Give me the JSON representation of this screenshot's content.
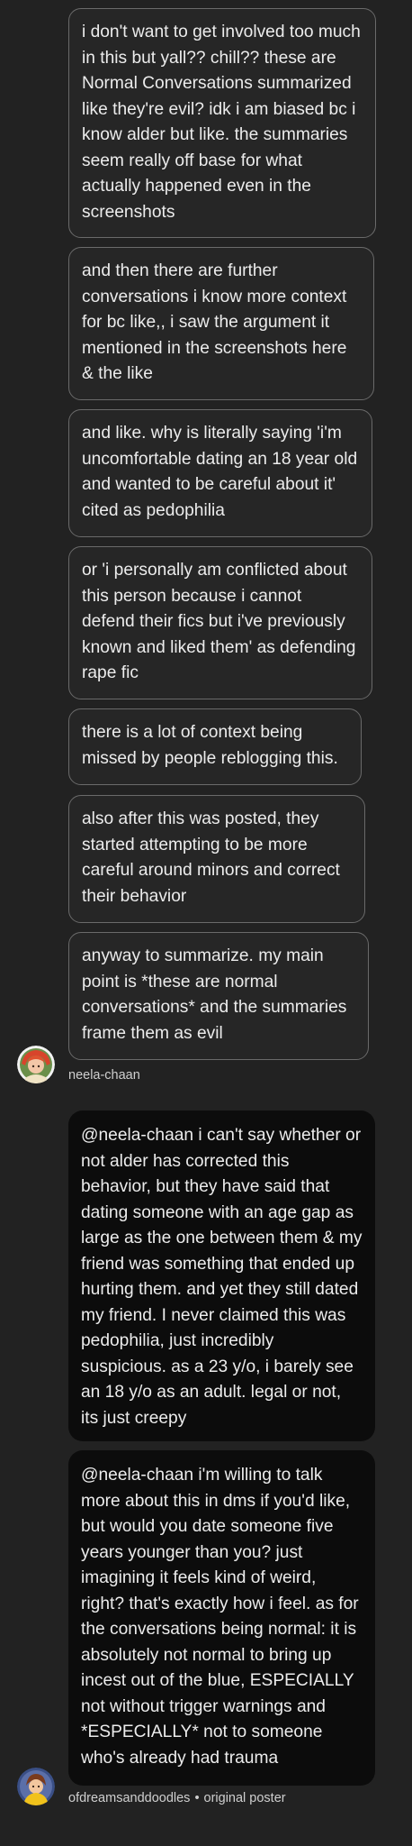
{
  "first_thread": {
    "messages": [
      {
        "text": "i don't want to get involved too much in this but yall?? chill?? these are Normal Conversations summarized like they're evil? idk i am biased bc i know alder but like. the summaries seem really off base for what actually happened even in the screenshots"
      },
      {
        "text": "and then there are further conversations i know more context for bc like,, i saw the argument it mentioned in the screenshots here & the like"
      },
      {
        "text": "and like. why is literally saying 'i'm uncomfortable dating an 18 year old and wanted to be careful about it' cited as pedophilia"
      },
      {
        "text": "or 'i personally am conflicted about this person because i cannot defend their fics but i've previously known and liked them' as defending rape fic"
      },
      {
        "text": "there is a lot of context being missed by people reblogging this."
      },
      {
        "text": "also after this was posted, they started attempting to be more careful around minors and correct their behavior"
      },
      {
        "text": "anyway to summarize. my main point is *these are normal conversations* and the summaries frame them as evil"
      }
    ],
    "author": {
      "username": "neela-chaan",
      "avatar_icon": "avatar-red-haired-character-icon"
    }
  },
  "second_thread": {
    "messages": [
      {
        "text": "@neela-chaan i can't say whether or not alder has corrected this behavior, but they have said that dating someone with an age gap as large as the one between them & my friend was something that ended up hurting them. and yet they still dated my friend. I never claimed this was pedophilia, just incredibly suspicious. as a 23 y/o, i barely see an 18 y/o as an adult. legal or not, its just creepy"
      },
      {
        "text": "@neela-chaan i'm willing to talk more about this in dms if you'd like, but would you date someone five years younger than you? just imagining it feels kind of weird, right? that's exactly how i feel. as for the conversations being normal: it is absolutely not normal to bring up incest out of the blue, ESPECIALLY not without trigger warnings and *ESPECIALLY* not to someone who's already had trauma"
      }
    ],
    "author": {
      "username": "ofdreamsanddoodles",
      "separator": "•",
      "role": "original poster",
      "avatar_icon": "avatar-yellow-character-icon"
    }
  },
  "colors": {
    "background": "#222222",
    "reply_bubble_border": "#6a6a6a",
    "op_bubble_background": "#0c0c0c",
    "text": "#ececec"
  }
}
